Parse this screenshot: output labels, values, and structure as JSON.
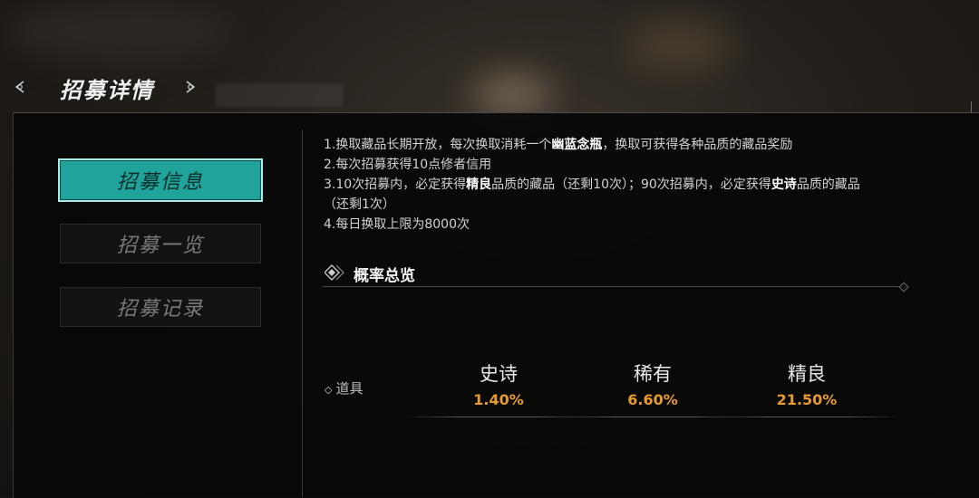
{
  "header": {
    "title": "招募详情"
  },
  "sidebar": {
    "items": [
      {
        "label": "招募信息",
        "active": true
      },
      {
        "label": "招募一览",
        "active": false
      },
      {
        "label": "招募记录",
        "active": false
      }
    ]
  },
  "rules": {
    "line1_a": "1.换取藏品长期开放，每次换取消耗一个",
    "line1_bold": "幽蓝念瓶",
    "line1_b": "，换取可获得各种品质的藏品奖励",
    "line2": "2.每次招募获得10点修者信用",
    "line3_a": "3.10次招募内，必定获得",
    "line3_bold1": "精良",
    "line3_b": "品质的藏品（还剩10次）；90次招募内，必定获得",
    "line3_bold2": "史诗",
    "line3_c": "品质的藏品",
    "line3_d": "（还剩1次）",
    "line4": "4.每日换取上限为8000次"
  },
  "overview": {
    "title": "概率总览",
    "row_label": "道具",
    "columns": [
      {
        "name": "史诗",
        "value": "1.40%"
      },
      {
        "name": "稀有",
        "value": "6.60%"
      },
      {
        "name": "精良",
        "value": "21.50%"
      }
    ]
  },
  "colors": {
    "accent_teal": "#1fa39a",
    "percent_orange": "#e69a2d"
  }
}
